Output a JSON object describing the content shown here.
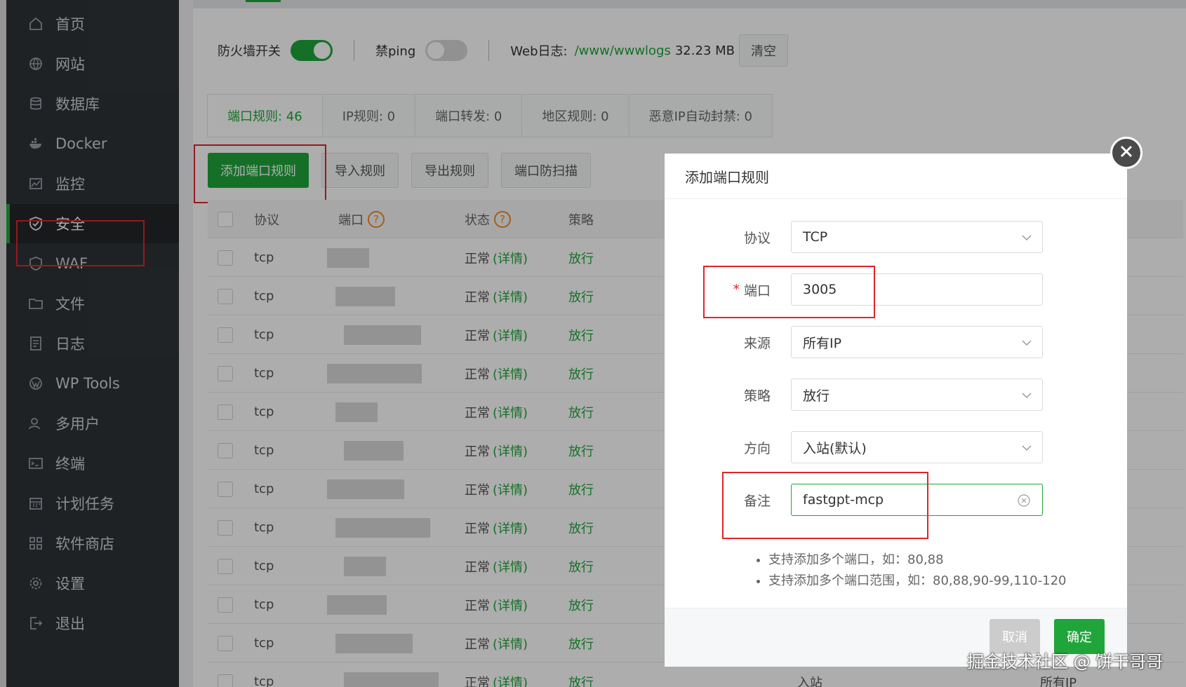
{
  "sidebar": {
    "items": [
      {
        "label": "首页",
        "icon": "home-icon"
      },
      {
        "label": "网站",
        "icon": "globe-icon"
      },
      {
        "label": "数据库",
        "icon": "database-icon"
      },
      {
        "label": "Docker",
        "icon": "docker-icon"
      },
      {
        "label": "监控",
        "icon": "monitor-icon"
      },
      {
        "label": "安全",
        "icon": "shield-icon",
        "active": true
      },
      {
        "label": "WAF",
        "icon": "waf-shield-icon"
      },
      {
        "label": "文件",
        "icon": "folder-icon"
      },
      {
        "label": "日志",
        "icon": "log-icon"
      },
      {
        "label": "WP Tools",
        "icon": "wordpress-icon"
      },
      {
        "label": "多用户",
        "icon": "users-icon"
      },
      {
        "label": "终端",
        "icon": "terminal-icon"
      },
      {
        "label": "计划任务",
        "icon": "calendar-icon"
      },
      {
        "label": "软件商店",
        "icon": "grid-icon"
      },
      {
        "label": "设置",
        "icon": "gear-icon"
      },
      {
        "label": "退出",
        "icon": "logout-icon"
      }
    ]
  },
  "options": {
    "firewall_label": "防火墙开关",
    "firewall_on": true,
    "noping_label": "禁ping",
    "noping_on": false,
    "weblog_label": "Web日志:",
    "weblog_path": "/www/wwwlogs",
    "weblog_size": "32.23 MB",
    "clear_label": "清空"
  },
  "stat_tabs": [
    {
      "label": "端口规则: 46",
      "active": true
    },
    {
      "label": "IP规则: 0"
    },
    {
      "label": "端口转发: 0"
    },
    {
      "label": "地区规则: 0"
    },
    {
      "label": "恶意IP自动封禁: 0"
    }
  ],
  "actions": {
    "add": "添加端口规则",
    "import": "导入规则",
    "export": "导出规则",
    "scan": "端口防扫描"
  },
  "table": {
    "headers": {
      "protocol": "协议",
      "port": "端口",
      "status": "状态",
      "policy": "策略"
    },
    "rows": [
      {
        "protocol": "tcp",
        "status": "正常",
        "detail": "(详情)",
        "policy": "放行"
      },
      {
        "protocol": "tcp",
        "status": "正常",
        "detail": "(详情)",
        "policy": "放行"
      },
      {
        "protocol": "tcp",
        "status": "正常",
        "detail": "(详情)",
        "policy": "放行"
      },
      {
        "protocol": "tcp",
        "status": "正常",
        "detail": "(详情)",
        "policy": "放行"
      },
      {
        "protocol": "tcp",
        "status": "正常",
        "detail": "(详情)",
        "policy": "放行"
      },
      {
        "protocol": "tcp",
        "status": "正常",
        "detail": "(详情)",
        "policy": "放行"
      },
      {
        "protocol": "tcp",
        "status": "正常",
        "detail": "(详情)",
        "policy": "放行"
      },
      {
        "protocol": "tcp",
        "status": "正常",
        "detail": "(详情)",
        "policy": "放行"
      },
      {
        "protocol": "tcp",
        "status": "正常",
        "detail": "(详情)",
        "policy": "放行"
      },
      {
        "protocol": "tcp",
        "status": "正常",
        "detail": "(详情)",
        "policy": "放行"
      },
      {
        "protocol": "tcp",
        "status": "正常",
        "detail": "(详情)",
        "policy": "放行"
      },
      {
        "protocol": "tcp",
        "status": "正常",
        "detail": "(详情)",
        "policy": "放行",
        "direction": "入站",
        "source": "所有IP"
      }
    ]
  },
  "modal": {
    "title": "添加端口规则",
    "fields": {
      "protocol": {
        "label": "协议",
        "value": "TCP"
      },
      "port": {
        "label": "端口",
        "required_mark": "*",
        "value": "3005"
      },
      "source": {
        "label": "来源",
        "value": "所有IP"
      },
      "policy": {
        "label": "策略",
        "value": "放行"
      },
      "direction": {
        "label": "方向",
        "value": "入站(默认)"
      },
      "remark": {
        "label": "备注",
        "value": "fastgpt-mcp"
      }
    },
    "tips": [
      "支持添加多个端口，如：80,88",
      "支持添加多个端口范围，如：80,88,90-99,110-120"
    ],
    "cancel": "取消",
    "confirm": "确定"
  },
  "watermark": "掘金技术社区 @ 饼干哥哥",
  "colors": {
    "accent": "#20a53a",
    "highlight": "#e0242e",
    "sidebar_bg": "#2f3337"
  }
}
